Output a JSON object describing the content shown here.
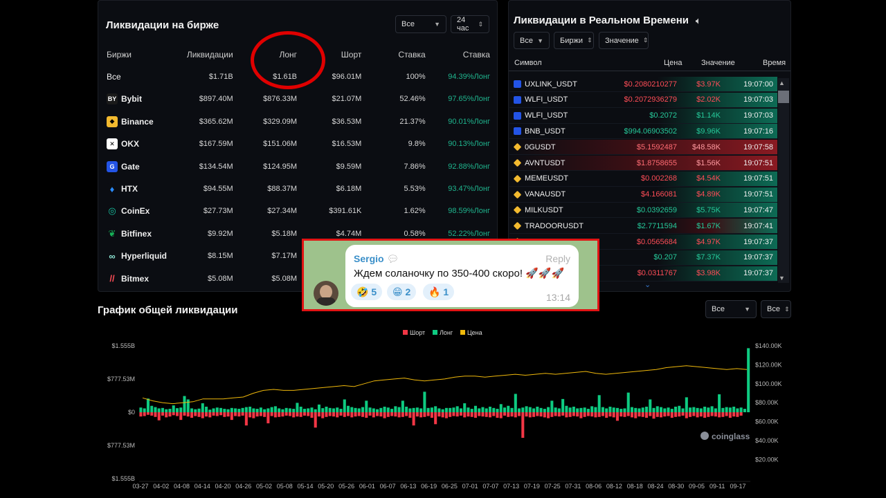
{
  "exchange_panel": {
    "title": "Ликвидации на бирже",
    "filter_all": "Все",
    "filter_period": "24 час",
    "columns": [
      "Биржи",
      "Ликвидации",
      "Лонг",
      "Шорт",
      "Ставка",
      "Ставка"
    ],
    "rows": [
      {
        "name": "Все",
        "icon": "none",
        "liq": "$1.71B",
        "long": "$1.61B",
        "short": "$96.01M",
        "rate": "100%",
        "ratio": "94.39%Лонг"
      },
      {
        "name": "Bybit",
        "icon": "bybit-icon",
        "liq": "$897.40M",
        "long": "$876.33M",
        "short": "$21.07M",
        "rate": "52.46%",
        "ratio": "97.65%Лонг"
      },
      {
        "name": "Binance",
        "icon": "binance-icon",
        "liq": "$365.62M",
        "long": "$329.09M",
        "short": "$36.53M",
        "rate": "21.37%",
        "ratio": "90.01%Лонг"
      },
      {
        "name": "OKX",
        "icon": "okx-icon",
        "liq": "$167.59M",
        "long": "$151.06M",
        "short": "$16.53M",
        "rate": "9.8%",
        "ratio": "90.13%Лонг"
      },
      {
        "name": "Gate",
        "icon": "gate-icon",
        "liq": "$134.54M",
        "long": "$124.95M",
        "short": "$9.59M",
        "rate": "7.86%",
        "ratio": "92.88%Лонг"
      },
      {
        "name": "HTX",
        "icon": "htx-icon",
        "liq": "$94.55M",
        "long": "$88.37M",
        "short": "$6.18M",
        "rate": "5.53%",
        "ratio": "93.47%Лонг"
      },
      {
        "name": "CoinEx",
        "icon": "coinex-icon",
        "liq": "$27.73M",
        "long": "$27.34M",
        "short": "$391.61K",
        "rate": "1.62%",
        "ratio": "98.59%Лонг"
      },
      {
        "name": "Bitfinex",
        "icon": "bitfinex-icon",
        "liq": "$9.92M",
        "long": "$5.18M",
        "short": "$4.74M",
        "rate": "0.58%",
        "ratio": "52.22%Лонг"
      },
      {
        "name": "Hyperliquid",
        "icon": "hyperliquid-icon",
        "liq": "$8.15M",
        "long": "$7.17M",
        "short": "",
        "rate": "",
        "ratio": ""
      },
      {
        "name": "Bitmex",
        "icon": "bitmex-icon",
        "liq": "$5.08M",
        "long": "$5.08M",
        "short": "",
        "rate": "",
        "ratio": ""
      }
    ]
  },
  "realtime_panel": {
    "title": "Ликвидации в Реальном Времени",
    "filters": [
      "Все",
      "Биржи",
      "Значение"
    ],
    "columns": [
      "Символ",
      "Цена",
      "Значение",
      "Время"
    ],
    "rows": [
      {
        "symbol": "UXLINK_USDT",
        "price": "$0.2080210277",
        "value": "$3.97K",
        "time": "19:07:00",
        "side": "long"
      },
      {
        "symbol": "WLFI_USDT",
        "price": "$0.2072936279",
        "value": "$2.02K",
        "time": "19:07:03",
        "side": "long"
      },
      {
        "symbol": "WLFI_USDT",
        "price": "$0.2072",
        "value": "$1.14K",
        "time": "19:07:03",
        "side": "short"
      },
      {
        "symbol": "BNB_USDT",
        "price": "$994.06903502",
        "value": "$9.96K",
        "time": "19:07:16",
        "side": "short"
      },
      {
        "symbol": "0GUSDT",
        "price": "$5.1592487",
        "value": "$48.58K",
        "time": "19:07:58",
        "side": "long-big"
      },
      {
        "symbol": "AVNTUSDT",
        "price": "$1.8758655",
        "value": "$1.56K",
        "time": "19:07:51",
        "side": "long-big"
      },
      {
        "symbol": "MEMEUSDT",
        "price": "$0.002268",
        "value": "$4.54K",
        "time": "19:07:51",
        "side": "long"
      },
      {
        "symbol": "VANAUSDT",
        "price": "$4.166081",
        "value": "$4.89K",
        "time": "19:07:51",
        "side": "long"
      },
      {
        "symbol": "MILKUSDT",
        "price": "$0.0392659",
        "value": "$5.75K",
        "time": "19:07:47",
        "side": "short"
      },
      {
        "symbol": "TRADOORUSDT",
        "price": "$2.7711594",
        "value": "$1.67K",
        "time": "19:07:41",
        "side": "mixed"
      },
      {
        "symbol": "",
        "price": "$0.0565684",
        "value": "$4.97K",
        "time": "19:07:37",
        "side": "long"
      },
      {
        "symbol": "",
        "price": "$0.207",
        "value": "$7.37K",
        "time": "19:07:37",
        "side": "short"
      },
      {
        "symbol": "",
        "price": "$0.0311767",
        "value": "$3.98K",
        "time": "19:07:37",
        "side": "long"
      }
    ]
  },
  "chart_section": {
    "title": "График общей ликвидации",
    "filter_all": "Все",
    "filter_all_2": "Все",
    "watermark": "coinglass"
  },
  "chart_data": {
    "type": "bar",
    "legend": [
      "Шорт",
      "Лонг",
      "Цена"
    ],
    "colors": {
      "short": "#f23645",
      "long": "#0ecb81",
      "price": "#f0b90b"
    },
    "y_left_ticks": [
      "$1.555B",
      "$777.53M",
      "$0",
      "$777.53M",
      "$1.555B"
    ],
    "y_right_ticks": [
      "$140.00K",
      "$120.00K",
      "$100.00K",
      "$80.00K",
      "$60.00K",
      "$40.00K",
      "$20.00K"
    ],
    "x_ticks": [
      "03-27",
      "04-02",
      "04-08",
      "04-14",
      "04-20",
      "04-26",
      "05-02",
      "05-08",
      "05-14",
      "05-20",
      "05-26",
      "06-01",
      "06-07",
      "06-13",
      "06-19",
      "06-25",
      "07-01",
      "07-07",
      "07-13",
      "07-19",
      "07-25",
      "07-31",
      "08-06",
      "08-12",
      "08-18",
      "08-24",
      "08-30",
      "09-05",
      "09-11",
      "09-17"
    ],
    "ylim": [
      -1555,
      1555
    ],
    "y2lim": [
      0,
      140
    ],
    "long": [
      110,
      90,
      320,
      150,
      120,
      90,
      100,
      70,
      80,
      160,
      95,
      110,
      380,
      300,
      90,
      70,
      85,
      210,
      130,
      60,
      90,
      110,
      100,
      80,
      70,
      100,
      90,
      80,
      100,
      120,
      130,
      90,
      80,
      110,
      70,
      90,
      120,
      140,
      90,
      70,
      100,
      90,
      80,
      220,
      130,
      80,
      90,
      110,
      70,
      180,
      95,
      130,
      100,
      90,
      110,
      80,
      300,
      150,
      120,
      100,
      90,
      120,
      270,
      110,
      90,
      70,
      100,
      130,
      110,
      80,
      140,
      120,
      270,
      130,
      90,
      100,
      110,
      90,
      480,
      100,
      110,
      140,
      90,
      70,
      100,
      100,
      110,
      140,
      90,
      210,
      110,
      80,
      150,
      90,
      120,
      90,
      130,
      100,
      80,
      190,
      110,
      150,
      100,
      430,
      90,
      110,
      140,
      120,
      90,
      130,
      100,
      80,
      120,
      270,
      110,
      90,
      310,
      150,
      110,
      130,
      90,
      100,
      110,
      80,
      140,
      120,
      400,
      120,
      90,
      130,
      110,
      100,
      80,
      90,
      460,
      120,
      100,
      90,
      110,
      130,
      300,
      100,
      140,
      120,
      90,
      110,
      80,
      130,
      150,
      90,
      350,
      110,
      120,
      100,
      90,
      130,
      110,
      140,
      90,
      420,
      100,
      120,
      110,
      130,
      90,
      110,
      80,
      1500
    ],
    "short": [
      100,
      90,
      60,
      80,
      110,
      190,
      80,
      120,
      100,
      70,
      90,
      180,
      80,
      100,
      130,
      90,
      110,
      140,
      100,
      120,
      80,
      90,
      70,
      110,
      100,
      180,
      90,
      100,
      80,
      310,
      120,
      140,
      100,
      90,
      110,
      260,
      90,
      120,
      110,
      100,
      80,
      90,
      120,
      100,
      110,
      80,
      90,
      130,
      360,
      100,
      140,
      110,
      90,
      100,
      120,
      80,
      110,
      90,
      120,
      100,
      90,
      110,
      130,
      80,
      120,
      90,
      100,
      140,
      110,
      90,
      100,
      120,
      110,
      90,
      130,
      310,
      100,
      120,
      110,
      90,
      130,
      280,
      100,
      120,
      140,
      110,
      90,
      100,
      80,
      120,
      100,
      110,
      130,
      90,
      100,
      110,
      120,
      90,
      130,
      140,
      80,
      110,
      100,
      120,
      90,
      600,
      100,
      120,
      110,
      90,
      100,
      120,
      140,
      110,
      90,
      100,
      80,
      120,
      110,
      90,
      100,
      140,
      110,
      90,
      100,
      120,
      110,
      90,
      130,
      100,
      120,
      200,
      100,
      110,
      90,
      120,
      140,
      100,
      110,
      130,
      90,
      150,
      110,
      120,
      100,
      90,
      130,
      110,
      100,
      80,
      140,
      110,
      90,
      120,
      100,
      130,
      110,
      90,
      100,
      120,
      110,
      90,
      130,
      100,
      110,
      80
    ],
    "price": [
      85,
      82,
      80,
      79,
      80,
      81,
      84,
      84,
      84,
      85,
      86,
      90,
      93,
      94,
      93,
      93,
      94,
      95,
      96,
      97,
      98,
      97,
      100,
      103,
      104,
      105,
      106,
      104,
      103,
      104,
      105,
      107,
      108,
      108,
      107,
      108,
      109,
      110,
      109,
      110,
      111,
      110,
      111,
      112,
      113,
      111,
      110,
      111,
      112,
      113,
      114,
      115,
      117,
      118,
      119,
      118,
      117,
      116,
      115,
      116,
      115
    ]
  },
  "chat_overlay": {
    "sender": "Sergio",
    "reply_label": "Reply",
    "message": "Ждем соланочку по 350-400 скоро! 🚀🚀🚀",
    "reactions": [
      {
        "emoji": "🤣",
        "count": "5"
      },
      {
        "emoji": "😁",
        "count": "2"
      },
      {
        "emoji": "🔥",
        "count": "1"
      }
    ],
    "time": "13:14"
  }
}
